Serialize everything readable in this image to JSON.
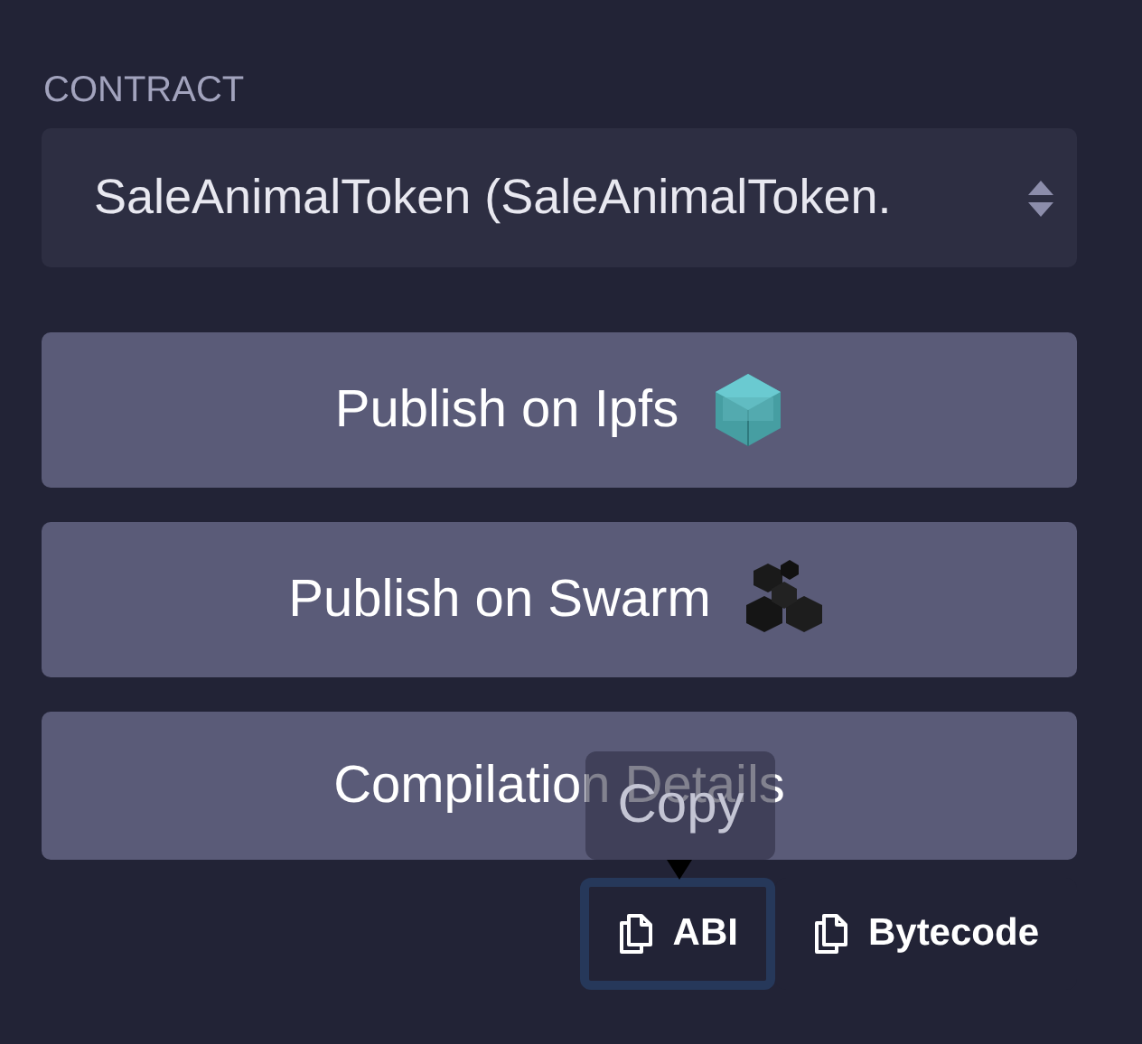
{
  "contract": {
    "label": "CONTRACT",
    "value": "SaleAnimalToken (SaleAnimalToken."
  },
  "buttons": [
    {
      "label": "Publish on Ipfs",
      "kind": "ipfs"
    },
    {
      "label": "Publish on Swarm",
      "kind": "swarm"
    },
    {
      "label": "Compilation Details",
      "kind": "plain"
    }
  ],
  "copy_buttons": [
    {
      "label": "ABI",
      "focused": true,
      "tooltip": "Copy"
    },
    {
      "label": "Bytecode",
      "focused": false
    }
  ]
}
